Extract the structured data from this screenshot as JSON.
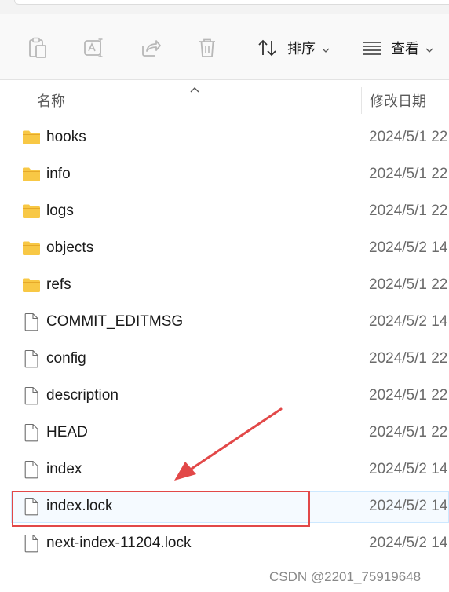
{
  "toolbar": {
    "sort_label": "排序",
    "view_label": "查看"
  },
  "columns": {
    "name": "名称",
    "date": "修改日期"
  },
  "files": [
    {
      "name": "hooks",
      "type": "folder",
      "date": "2024/5/1 22"
    },
    {
      "name": "info",
      "type": "folder",
      "date": "2024/5/1 22"
    },
    {
      "name": "logs",
      "type": "folder",
      "date": "2024/5/1 22"
    },
    {
      "name": "objects",
      "type": "folder",
      "date": "2024/5/2 14"
    },
    {
      "name": "refs",
      "type": "folder",
      "date": "2024/5/1 22"
    },
    {
      "name": "COMMIT_EDITMSG",
      "type": "file",
      "date": "2024/5/2 14"
    },
    {
      "name": "config",
      "type": "file",
      "date": "2024/5/1 22"
    },
    {
      "name": "description",
      "type": "file",
      "date": "2024/5/1 22"
    },
    {
      "name": "HEAD",
      "type": "file",
      "date": "2024/5/1 22"
    },
    {
      "name": "index",
      "type": "file",
      "date": "2024/5/2 14"
    },
    {
      "name": "index.lock",
      "type": "file",
      "date": "2024/5/2 14",
      "selected": true
    },
    {
      "name": "next-index-11204.lock",
      "type": "file",
      "date": "2024/5/2 14"
    }
  ],
  "icons": {
    "folder": "folder-icon",
    "file": "file-icon"
  },
  "colors": {
    "folder": "#f8c845",
    "annotation": "#e24848",
    "selection_border": "#cde8ff"
  },
  "watermark": "CSDN @2201_75919648"
}
